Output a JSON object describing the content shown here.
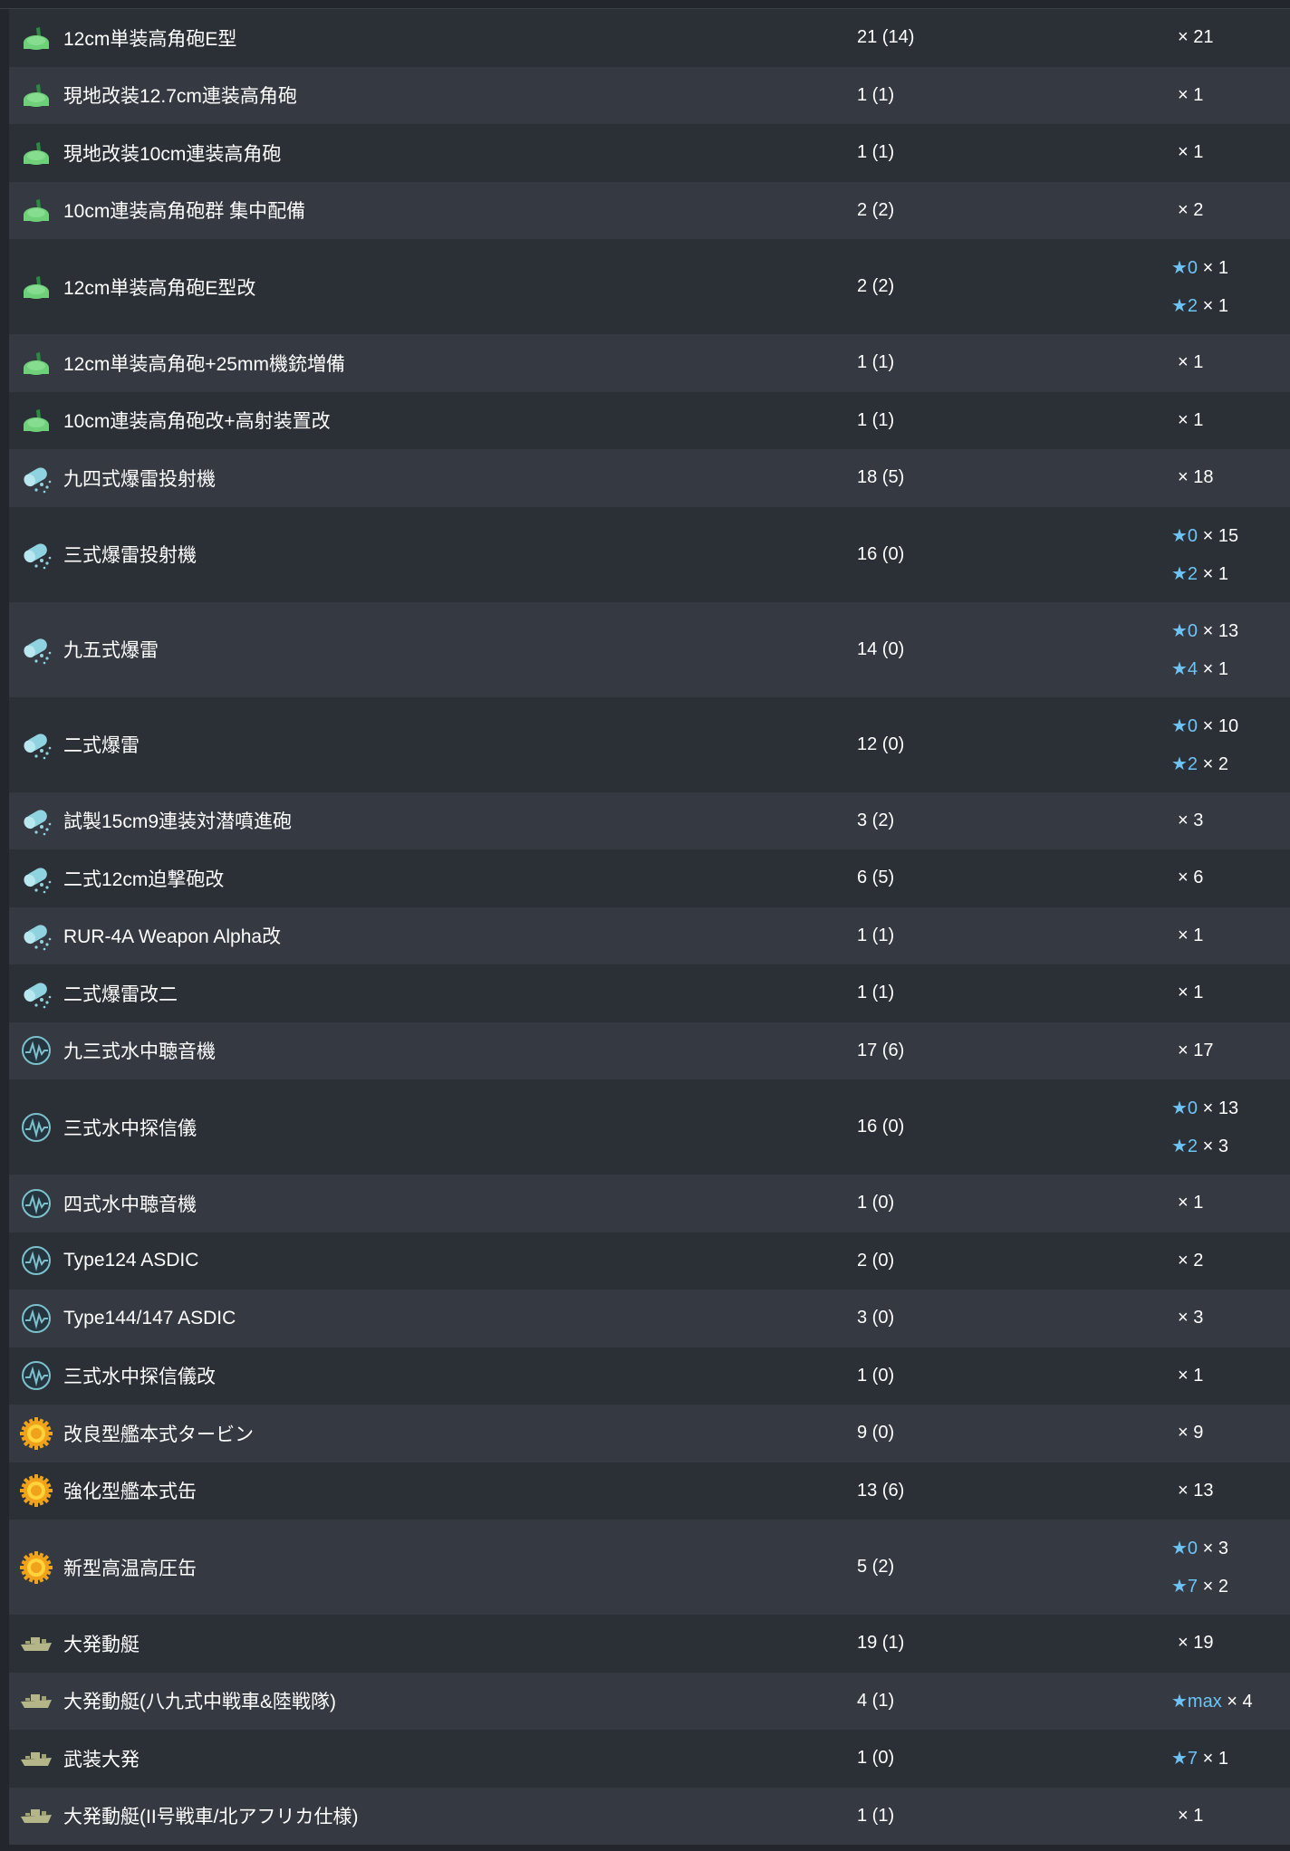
{
  "colors": {
    "row_odd": "#2b2f36",
    "row_even": "#353941",
    "star": "#6ec3f5",
    "text": "#ffffff"
  },
  "icons": {
    "aa_gun": "green-aa-gun-icon",
    "depth_charge": "depth-charge-icon",
    "sonar": "sonar-icon",
    "engine": "engine-gear-icon",
    "landing_craft": "landing-craft-icon"
  },
  "rows": [
    {
      "icon": "aa_gun",
      "name": "12cm単装高角砲E型",
      "count": "21 (14)",
      "stars": [
        {
          "star": "",
          "qty": "× 21"
        }
      ]
    },
    {
      "icon": "aa_gun",
      "name": "現地改装12.7cm連装高角砲",
      "count": "1 (1)",
      "stars": [
        {
          "star": "",
          "qty": "× 1"
        }
      ]
    },
    {
      "icon": "aa_gun",
      "name": "現地改装10cm連装高角砲",
      "count": "1 (1)",
      "stars": [
        {
          "star": "",
          "qty": "× 1"
        }
      ]
    },
    {
      "icon": "aa_gun",
      "name": "10cm連装高角砲群 集中配備",
      "count": "2 (2)",
      "stars": [
        {
          "star": "",
          "qty": "× 2"
        }
      ]
    },
    {
      "icon": "aa_gun",
      "name": "12cm単装高角砲E型改",
      "count": "2 (2)",
      "stars": [
        {
          "star": "★0",
          "qty": "× 1"
        },
        {
          "star": "★2",
          "qty": "× 1"
        }
      ]
    },
    {
      "icon": "aa_gun",
      "name": "12cm単装高角砲+25mm機銃増備",
      "count": "1 (1)",
      "stars": [
        {
          "star": "",
          "qty": "× 1"
        }
      ]
    },
    {
      "icon": "aa_gun",
      "name": "10cm連装高角砲改+高射装置改",
      "count": "1 (1)",
      "stars": [
        {
          "star": "",
          "qty": "× 1"
        }
      ]
    },
    {
      "icon": "depth_charge",
      "name": "九四式爆雷投射機",
      "count": "18 (5)",
      "stars": [
        {
          "star": "",
          "qty": "× 18"
        }
      ]
    },
    {
      "icon": "depth_charge",
      "name": "三式爆雷投射機",
      "count": "16 (0)",
      "stars": [
        {
          "star": "★0",
          "qty": "× 15"
        },
        {
          "star": "★2",
          "qty": "× 1"
        }
      ]
    },
    {
      "icon": "depth_charge",
      "name": "九五式爆雷",
      "count": "14 (0)",
      "stars": [
        {
          "star": "★0",
          "qty": "× 13"
        },
        {
          "star": "★4",
          "qty": "× 1"
        }
      ]
    },
    {
      "icon": "depth_charge",
      "name": "二式爆雷",
      "count": "12 (0)",
      "stars": [
        {
          "star": "★0",
          "qty": "× 10"
        },
        {
          "star": "★2",
          "qty": "× 2"
        }
      ]
    },
    {
      "icon": "depth_charge",
      "name": "試製15cm9連装対潜噴進砲",
      "count": "3 (2)",
      "stars": [
        {
          "star": "",
          "qty": "× 3"
        }
      ]
    },
    {
      "icon": "depth_charge",
      "name": "二式12cm迫撃砲改",
      "count": "6 (5)",
      "stars": [
        {
          "star": "",
          "qty": "× 6"
        }
      ]
    },
    {
      "icon": "depth_charge",
      "name": "RUR-4A Weapon Alpha改",
      "count": "1 (1)",
      "stars": [
        {
          "star": "",
          "qty": "× 1"
        }
      ]
    },
    {
      "icon": "depth_charge",
      "name": "二式爆雷改二",
      "count": "1 (1)",
      "stars": [
        {
          "star": "",
          "qty": "× 1"
        }
      ]
    },
    {
      "icon": "sonar",
      "name": "九三式水中聴音機",
      "count": "17 (6)",
      "stars": [
        {
          "star": "",
          "qty": "× 17"
        }
      ]
    },
    {
      "icon": "sonar",
      "name": "三式水中探信儀",
      "count": "16 (0)",
      "stars": [
        {
          "star": "★0",
          "qty": "× 13"
        },
        {
          "star": "★2",
          "qty": "× 3"
        }
      ]
    },
    {
      "icon": "sonar",
      "name": "四式水中聴音機",
      "count": "1 (0)",
      "stars": [
        {
          "star": "",
          "qty": "× 1"
        }
      ]
    },
    {
      "icon": "sonar",
      "name": "Type124 ASDIC",
      "count": "2 (0)",
      "stars": [
        {
          "star": "",
          "qty": "× 2"
        }
      ]
    },
    {
      "icon": "sonar",
      "name": "Type144/147 ASDIC",
      "count": "3 (0)",
      "stars": [
        {
          "star": "",
          "qty": "× 3"
        }
      ]
    },
    {
      "icon": "sonar",
      "name": "三式水中探信儀改",
      "count": "1 (0)",
      "stars": [
        {
          "star": "",
          "qty": "× 1"
        }
      ]
    },
    {
      "icon": "engine",
      "name": "改良型艦本式タービン",
      "count": "9 (0)",
      "stars": [
        {
          "star": "",
          "qty": "× 9"
        }
      ]
    },
    {
      "icon": "engine",
      "name": "強化型艦本式缶",
      "count": "13 (6)",
      "stars": [
        {
          "star": "",
          "qty": "× 13"
        }
      ]
    },
    {
      "icon": "engine",
      "name": "新型高温高圧缶",
      "count": "5 (2)",
      "stars": [
        {
          "star": "★0",
          "qty": "× 3"
        },
        {
          "star": "★7",
          "qty": "× 2"
        }
      ]
    },
    {
      "icon": "landing_craft",
      "name": "大発動艇",
      "count": "19 (1)",
      "stars": [
        {
          "star": "",
          "qty": "× 19"
        }
      ]
    },
    {
      "icon": "landing_craft",
      "name": "大発動艇(八九式中戦車&陸戦隊)",
      "count": "4 (1)",
      "stars": [
        {
          "star": "★max",
          "qty": "× 4"
        }
      ]
    },
    {
      "icon": "landing_craft",
      "name": "武装大発",
      "count": "1 (0)",
      "stars": [
        {
          "star": "★7",
          "qty": "× 1"
        }
      ]
    },
    {
      "icon": "landing_craft",
      "name": "大発動艇(II号戦車/北アフリカ仕様)",
      "count": "1 (1)",
      "stars": [
        {
          "star": "",
          "qty": "× 1"
        }
      ]
    }
  ]
}
